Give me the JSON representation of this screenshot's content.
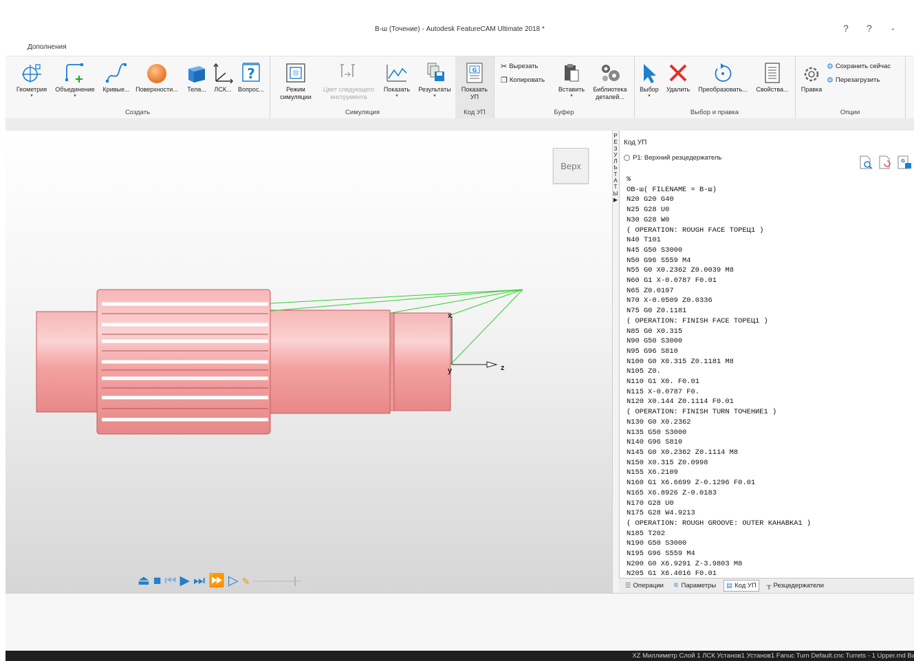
{
  "window": {
    "title": "В-ш (Точение) - Autodesk FeatureCAM Ultimate 2018 *",
    "controls": [
      "?",
      "?",
      "-"
    ]
  },
  "menu": {
    "left_fragment": "д",
    "addons": "Дополнения"
  },
  "ribbon": {
    "groups": {
      "create": "Создать",
      "simulation": "Симуляция",
      "nc_code": "Код УП",
      "clipboard": "Буфер",
      "select_edit": "Выбор и правка",
      "options": "Опции"
    },
    "create": {
      "geometry": "Геометрия",
      "union": "Объединение",
      "curves": "Кривые...",
      "surfaces": "Поверхности...",
      "solids": "Тела...",
      "ucs": "ЛСК...",
      "questions": "Вопрос..."
    },
    "simulation": {
      "mode_line1": "Режим",
      "mode_line2": "симуляции",
      "next_tool_line1": "Цвет следующего",
      "next_tool_line2": "инструмента",
      "show": "Показать",
      "results": "Результаты"
    },
    "nc_code": {
      "show_line1": "Показать",
      "show_line2": "УП"
    },
    "clipboard": {
      "cut": "Вырезать",
      "copy": "Копировать",
      "paste": "Вставить",
      "library_line1": "Библиотека",
      "library_line2": "деталей..."
    },
    "select_edit": {
      "select": "Выбор",
      "delete": "Удалить",
      "transform": "Преобразовать...",
      "properties": "Свойства..."
    },
    "options": {
      "edit": "Правка",
      "save_now": "Сохранить сейчас",
      "reload": "Перезагрузить"
    }
  },
  "viewport": {
    "view_cube": "Верх",
    "axis_x": "x",
    "axis_y": "y",
    "axis_z": "z"
  },
  "side_tab": {
    "letters": [
      "Р",
      "Е",
      "З",
      "У",
      "Л",
      "Ь",
      "Т",
      "А",
      "Т",
      "Ы",
      "▶"
    ]
  },
  "panel": {
    "title": "Код УП",
    "radio_label": "P1: Верхний резцедержатель",
    "code_lines": [
      "%",
      "ОВ-ш( FILENAME = В-ш)",
      "N20 G20 G40",
      "N25 G28 U0",
      "N30 G28 W0",
      "( OPERATION: ROUGH FACE ТОРЕЦ1 )",
      "N40 T101",
      "N45 G50 S3000",
      "N50 G96 S559 M4",
      "N55 G0 X0.2362 Z0.0039 M8",
      "N60 G1 X-0.0787 F0.01",
      "N65 Z0.0197",
      "N70 X-0.0509 Z0.0336",
      "N75 G0 Z0.1181",
      "( OPERATION: FINISH FACE ТОРЕЦ1 )",
      "N85 G0 X0.315",
      "N90 G50 S3000",
      "N95 G96 S810",
      "N100 G0 X0.315 Z0.1181 M8",
      "N105 Z0.",
      "N110 G1 X0. F0.01",
      "N115 X-0.0787 F0.",
      "N120 X0.144 Z0.1114 F0.01",
      "( OPERATION: FINISH TURN ТОЧЕНИЕ1 )",
      "N130 G0 X0.2362",
      "N135 G50 S3000",
      "N140 G96 S810",
      "N145 G0 X0.2362 Z0.1114 M8",
      "N150 X0.315 Z0.0998",
      "N155 X6.2109",
      "N160 G1 X6.6699 Z-0.1296 F0.01",
      "N165 X6.8926 Z-0.0183",
      "N170 G28 U0",
      "N175 G28 W4.9213",
      "( OPERATION: ROUGH GROOVE: OUTER КАНАВКА1 )",
      "N185 T202",
      "N190 G50 S3000",
      "N195 G96 S559 M4",
      "N200 G0 X6.9291 Z-3.9803 M8",
      "N205 G1 X6.4016 F0.01"
    ],
    "tabs": {
      "operations": "Операции",
      "parameters": "Параметры",
      "nc_code": "Код УП",
      "turrets": "Резцедержатели"
    }
  },
  "status": {
    "text": "XZ Миллиметр Слой 1 ЛСК Установ1 Установ1 Fanuc Turn Default.cnc Turrets - 1 Upper.md Ba"
  },
  "colors": {
    "part_fill": "#f3a0a0",
    "part_edge": "#c65a5a",
    "toolpath": "#33cc33",
    "accent_blue": "#1f7fd0",
    "delete_red": "#e03030",
    "status_bg": "#1e1e1e"
  }
}
